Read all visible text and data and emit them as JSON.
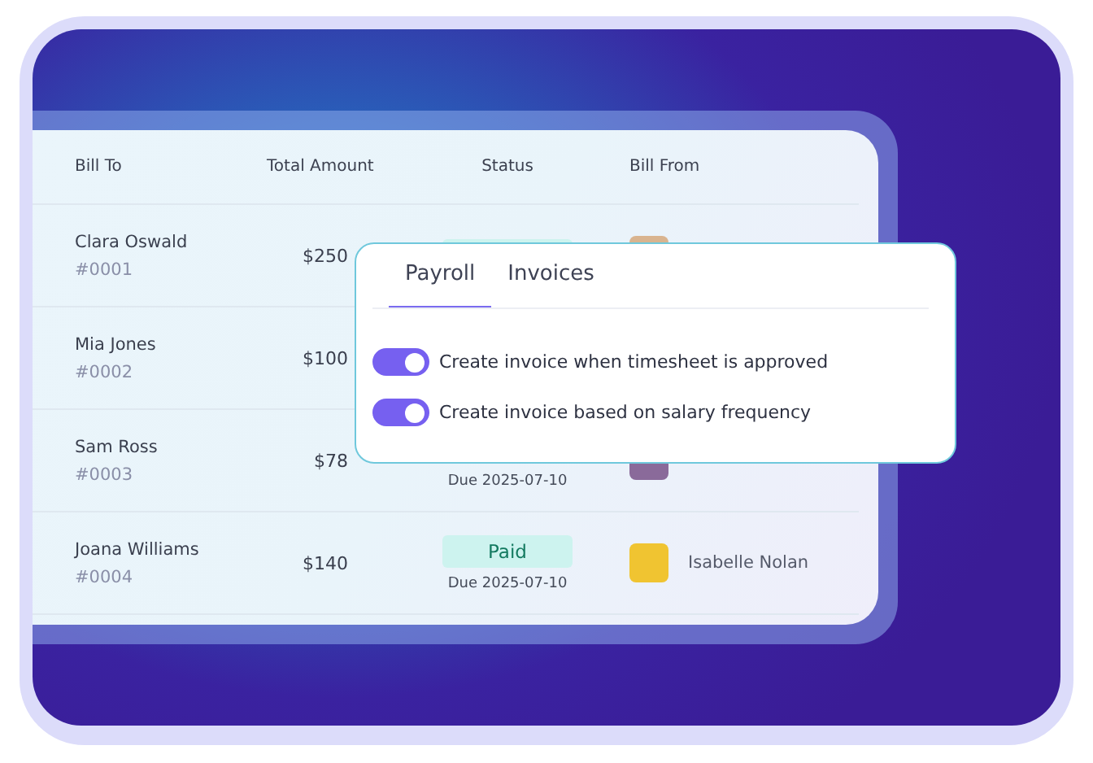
{
  "table": {
    "columns": [
      "Bill To",
      "Total Amount",
      "Status",
      "Bill From"
    ],
    "rows": [
      {
        "name": "Clara Oswald",
        "number": "#0001",
        "amount": "$250",
        "status": {
          "kind": "paid"
        },
        "bill_from": {
          "kind": "avatar"
        }
      },
      {
        "name": "Mia Jones",
        "number": "#0002",
        "amount": "$100"
      },
      {
        "name": "Sam Ross",
        "number": "#0003",
        "amount": "$78",
        "status": {
          "due": "Due 2025-07-10"
        },
        "bill_from": {
          "kind": "avatar"
        }
      },
      {
        "name": "Joana Williams",
        "number": "#0004",
        "amount": "$140",
        "status": {
          "kind": "paid",
          "label": "Paid",
          "due": "Due 2025-07-10"
        },
        "bill_from": {
          "kind": "avatar",
          "name": "Isabelle Nolan"
        }
      }
    ]
  },
  "popup": {
    "tabs": [
      {
        "label": "Payroll",
        "selected": true
      },
      {
        "label": "Invoices",
        "selected": false
      }
    ],
    "toggles": [
      {
        "label": "Create invoice when timesheet is approved",
        "on": true
      },
      {
        "label": "Create invoice based on salary frequency",
        "on": true
      }
    ]
  }
}
